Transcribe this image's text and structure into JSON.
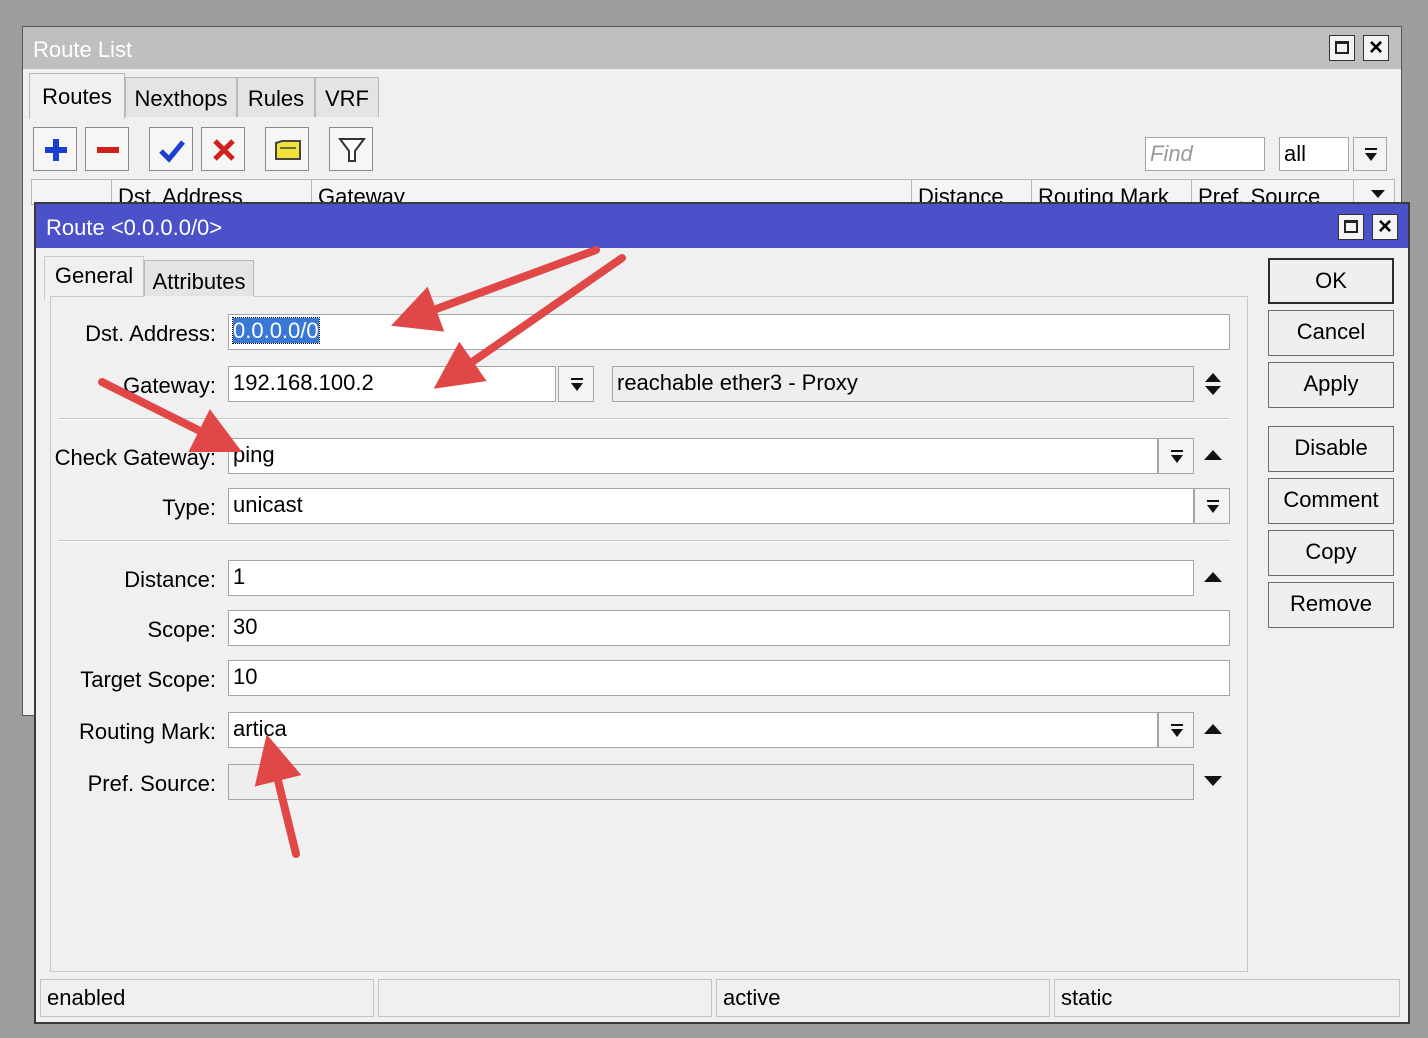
{
  "route_list": {
    "title": "Route List",
    "tabs": [
      {
        "label": "Routes",
        "active": true
      },
      {
        "label": "Nexthops",
        "active": false
      },
      {
        "label": "Rules",
        "active": false
      },
      {
        "label": "VRF",
        "active": false
      }
    ],
    "toolbar": {
      "add_icon": "plus-icon",
      "remove_icon": "minus-icon",
      "enable_icon": "checkmark-icon",
      "disable_icon": "x-icon",
      "comment_icon": "note-icon",
      "filter_icon": "filter-icon"
    },
    "find_placeholder": "Find",
    "filter_value": "all",
    "columns": [
      "Dst. Address",
      "Gateway",
      "Distance",
      "Routing Mark",
      "Pref. Source"
    ]
  },
  "dialog": {
    "title": "Route <0.0.0.0/0>",
    "title_bar_color": "#4b52c9",
    "tabs": [
      {
        "label": "General",
        "active": true
      },
      {
        "label": "Attributes",
        "active": false
      }
    ],
    "fields": {
      "dst_address": {
        "label": "Dst. Address:",
        "value": "0.0.0.0/0"
      },
      "gateway": {
        "label": "Gateway:",
        "value": "192.168.100.2",
        "status": "reachable ether3 - Proxy"
      },
      "check_gateway": {
        "label": "Check Gateway:",
        "value": "ping"
      },
      "type": {
        "label": "Type:",
        "value": "unicast"
      },
      "distance": {
        "label": "Distance:",
        "value": "1"
      },
      "scope": {
        "label": "Scope:",
        "value": "30"
      },
      "target_scope": {
        "label": "Target Scope:",
        "value": "10"
      },
      "routing_mark": {
        "label": "Routing Mark:",
        "value": "artica"
      },
      "pref_source": {
        "label": "Pref. Source:",
        "value": ""
      }
    },
    "buttons": {
      "ok": "OK",
      "cancel": "Cancel",
      "apply": "Apply",
      "disable": "Disable",
      "comment": "Comment",
      "copy": "Copy",
      "remove": "Remove"
    },
    "status_bar": [
      "enabled",
      "",
      "active",
      "static"
    ]
  },
  "annotation_color": "#e04848"
}
